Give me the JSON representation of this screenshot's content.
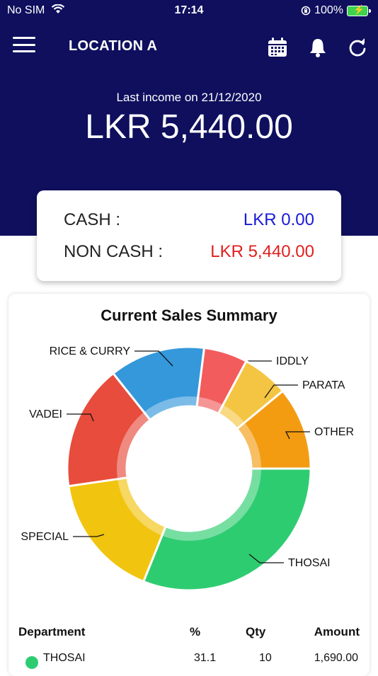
{
  "status": {
    "carrier": "No SIM",
    "time": "17:14",
    "battery": "100%"
  },
  "appbar": {
    "title": "LOCATION A"
  },
  "income": {
    "label": "Last income on 21/12/2020",
    "value": "LKR 5,440.00"
  },
  "cash": {
    "cash_label": "CASH :",
    "cash_value": "LKR 0.00",
    "noncash_label": "NON CASH :",
    "noncash_value": "LKR 5,440.00"
  },
  "colors": {
    "header_bg": "#0f0f5e",
    "cash_blue": "#1a1ad6",
    "noncash_red": "#e02020"
  },
  "summary": {
    "title": "Current Sales Summary"
  },
  "chart_data": {
    "type": "pie",
    "slices": [
      {
        "label": "THOSAI",
        "value": 31.1,
        "color": "#2ecc71"
      },
      {
        "label": "SPECIAL",
        "value": 16.6,
        "color": "#f1c40f"
      },
      {
        "label": "VADEI",
        "value": 16.6,
        "color": "#e74c3c"
      },
      {
        "label": "RICE & CURRY",
        "value": 12.7,
        "color": "#3498db"
      },
      {
        "label": "IDDLY",
        "value": 5.8,
        "color": "#f25c5c"
      },
      {
        "label": "PARATA",
        "value": 6.2,
        "color": "#f4c542"
      },
      {
        "label": "OTHER",
        "value": 11.0,
        "color": "#f39c12"
      }
    ]
  },
  "table": {
    "headers": {
      "dept": "Department",
      "pct": "%",
      "qty": "Qty",
      "amount": "Amount"
    },
    "rows": [
      {
        "dept": "THOSAI",
        "pct": "31.1",
        "qty": "10",
        "amount": "1,690.00",
        "color": "#2ecc71"
      }
    ]
  }
}
